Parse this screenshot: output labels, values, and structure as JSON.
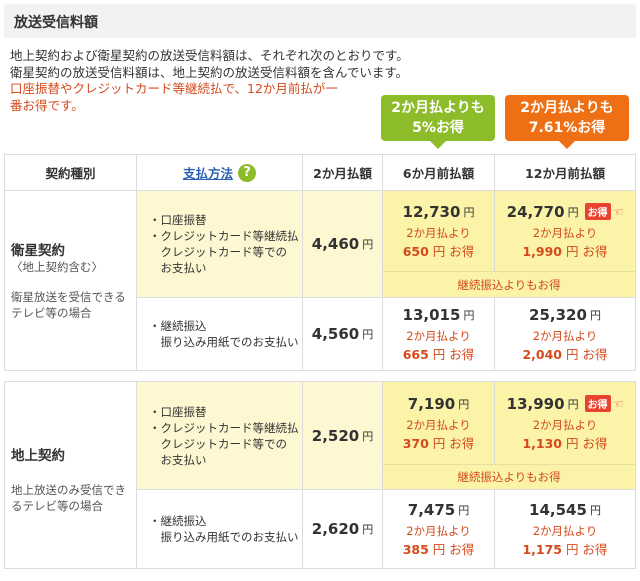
{
  "header": {
    "title": "放送受信料額"
  },
  "intro": {
    "line1": "地上契約および衛星契約の放送受信料額は、それぞれ次のとおりです。",
    "line2": "衛星契約の放送受信料額は、地上契約の放送受信料額を含んでいます。",
    "line3": "口座振替やクレジットカード等継続払で、12か月前払が一",
    "line4": "番お得です。"
  },
  "bubbles": {
    "green": {
      "line1": "2か月払よりも",
      "line2": "5%お得"
    },
    "orange": {
      "line1": "2か月払よりも",
      "line2": "7.61%お得"
    }
  },
  "table_header": {
    "type": "契約種別",
    "method": "支払方法",
    "help_icon": "question-icon",
    "two_month": "2か月払額",
    "six_month": "6か月前払額",
    "twelve_month": "12か月前払額"
  },
  "common": {
    "yen": "円",
    "from_two_month": "2か月払より",
    "otoku": "お得",
    "otoku_badge": "お得",
    "band": "継続振込よりもお得"
  },
  "sections": [
    {
      "title": "衛星契約",
      "subtitle": "〈地上契約含む〉",
      "desc1": "衛星放送を受信できる",
      "desc2": "テレビ等の場合",
      "rows": [
        {
          "method": [
            "・口座振替",
            "・クレジットカード等継続払",
            "　クレジットカード等での",
            "　お支払い"
          ],
          "two_month": "4,460",
          "six_month": "12,730",
          "six_save": "650",
          "twelve_month": "24,770",
          "twelve_save": "1,990"
        },
        {
          "method": [
            "・継続振込",
            "　振り込み用紙でのお支払い"
          ],
          "two_month": "4,560",
          "six_month": "13,015",
          "six_save": "665",
          "twelve_month": "25,320",
          "twelve_save": "2,040"
        }
      ]
    },
    {
      "title": "地上契約",
      "subtitle": "",
      "desc1": "地上放送のみ受信でき",
      "desc2": "るテレビ等の場合",
      "rows": [
        {
          "method": [
            "・口座振替",
            "・クレジットカード等継続払",
            "　クレジットカード等での",
            "　お支払い"
          ],
          "two_month": "2,520",
          "six_month": "7,190",
          "six_save": "370",
          "twelve_month": "13,990",
          "twelve_save": "1,130"
        },
        {
          "method": [
            "・継続振込",
            "　振り込み用紙でのお支払い"
          ],
          "two_month": "2,620",
          "six_month": "7,475",
          "six_save": "385",
          "twelve_month": "14,545",
          "twelve_save": "1,175"
        }
      ]
    }
  ]
}
